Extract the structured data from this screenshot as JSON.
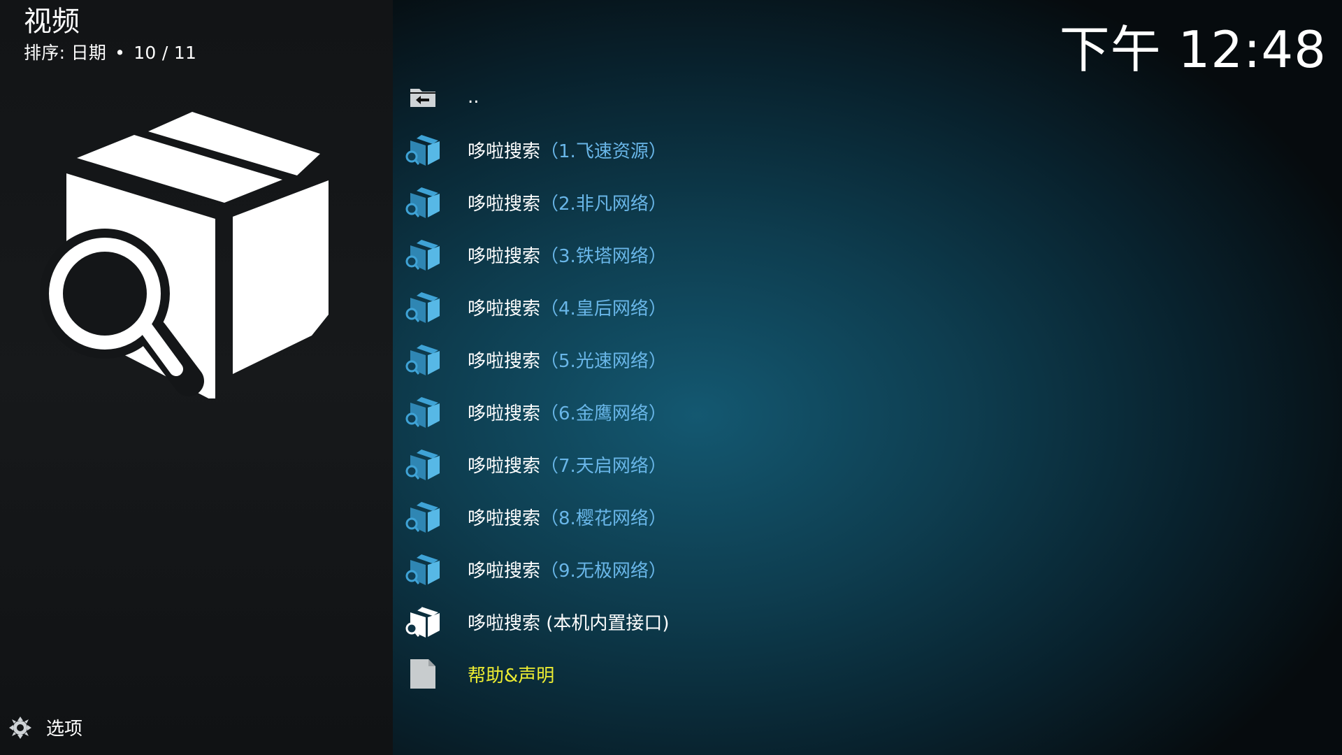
{
  "header": {
    "title": "视频",
    "sort_label": "排序: 日期",
    "separator": "•",
    "position": "10 / 11"
  },
  "clock": "下午 12:48",
  "addon_icon": "box-search-icon",
  "list": {
    "parent": {
      "label": "..",
      "icon": "folder-back-icon"
    },
    "items": [
      {
        "name": "哆啦搜索",
        "suffix": "（1.飞速资源）",
        "icon": "box-search-icon"
      },
      {
        "name": "哆啦搜索",
        "suffix": "（2.非凡网络）",
        "icon": "box-search-icon"
      },
      {
        "name": "哆啦搜索",
        "suffix": "（3.铁塔网络）",
        "icon": "box-search-icon"
      },
      {
        "name": "哆啦搜索",
        "suffix": "（4.皇后网络）",
        "icon": "box-search-icon"
      },
      {
        "name": "哆啦搜索",
        "suffix": "（5.光速网络）",
        "icon": "box-search-icon"
      },
      {
        "name": "哆啦搜索",
        "suffix": "（6.金鹰网络）",
        "icon": "box-search-icon"
      },
      {
        "name": "哆啦搜索",
        "suffix": "（7.天启网络）",
        "icon": "box-search-icon"
      },
      {
        "name": "哆啦搜索",
        "suffix": "（8.樱花网络）",
        "icon": "box-search-icon"
      },
      {
        "name": "哆啦搜索",
        "suffix": "（9.无极网络）",
        "icon": "box-search-icon"
      }
    ],
    "builtin": {
      "label": "哆啦搜索 (本机内置接口)",
      "icon": "box-search-icon"
    },
    "help": {
      "label": "帮助&声明",
      "icon": "document-icon"
    }
  },
  "options": {
    "label": "选项",
    "icon": "gear-icon"
  },
  "colors": {
    "accent_blue": "#69b6e8",
    "help_yellow": "#ecec32",
    "icon_blue": "#3fa3d6"
  }
}
